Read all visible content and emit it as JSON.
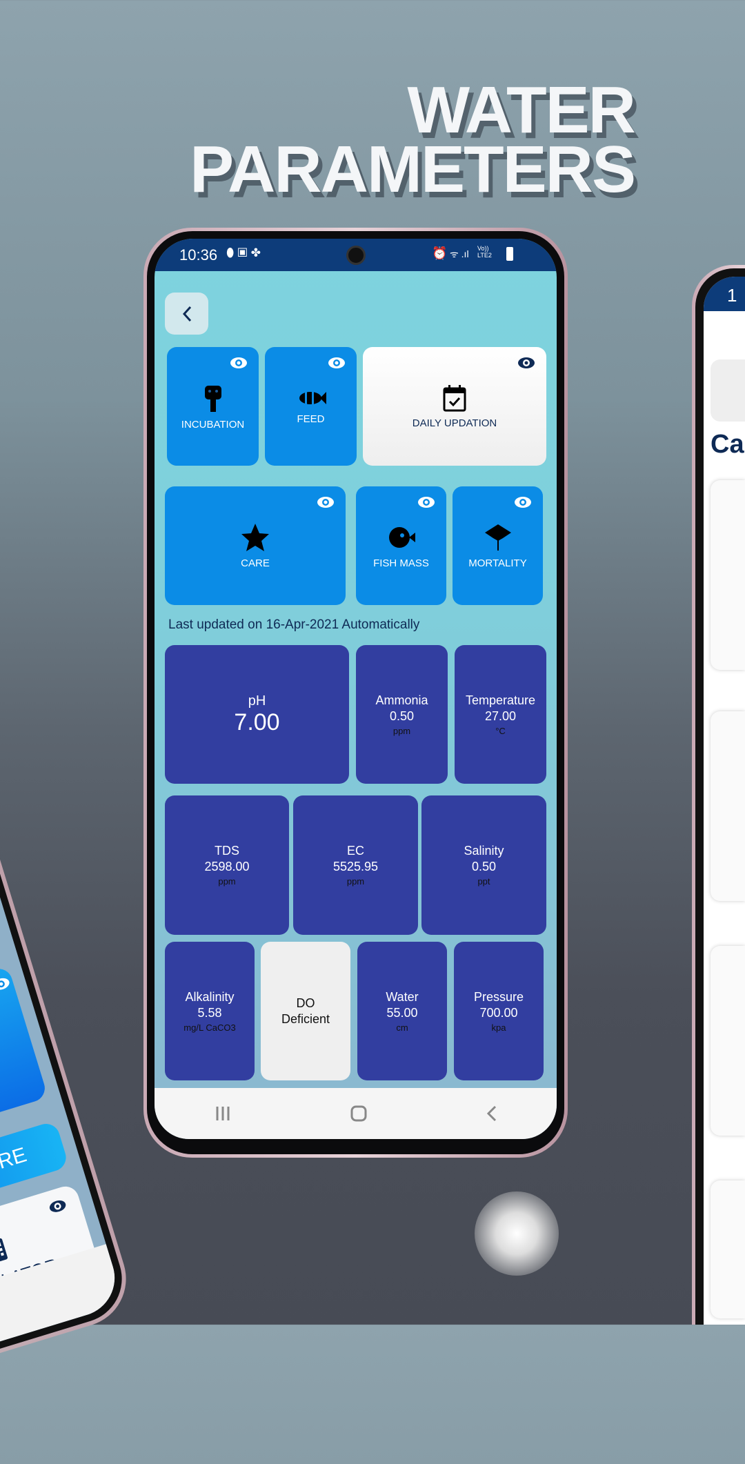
{
  "headline": {
    "line1": "WATER",
    "line2": "PARAMETERS"
  },
  "status_bar": {
    "time": "10:36",
    "network": "Vo)) LTE2"
  },
  "menu_tiles": [
    {
      "label": "INCUBATION",
      "icon": "incubator-icon"
    },
    {
      "label": "FEED",
      "icon": "clownfish-icon"
    },
    {
      "label": "DAILY UPDATION",
      "icon": "calendar-check-icon"
    },
    {
      "label": "CARE",
      "icon": "starfish-icon"
    },
    {
      "label": "FISH MASS",
      "icon": "pufferfish-icon"
    },
    {
      "label": "MORTALITY",
      "icon": "stingray-icon"
    }
  ],
  "last_updated": "Last updated on 16-Apr-2021 Automatically",
  "parameters": [
    {
      "label": "pH",
      "value": "7.00",
      "unit": ""
    },
    {
      "label": "Ammonia",
      "value": "0.50",
      "unit": "ppm"
    },
    {
      "label": "Temperature",
      "value": "27.00",
      "unit": "°C"
    },
    {
      "label": "TDS",
      "value": "2598.00",
      "unit": "ppm"
    },
    {
      "label": "EC",
      "value": "5525.95",
      "unit": "ppm"
    },
    {
      "label": "Salinity",
      "value": "0.50",
      "unit": "ppt"
    },
    {
      "label": "Alkalinity",
      "value": "5.58",
      "unit": "mg/L CaCO3"
    },
    {
      "label": "DO",
      "value": "Deficient",
      "unit": ""
    },
    {
      "label": "Water",
      "value": "55.00",
      "unit": "cm"
    },
    {
      "label": "Pressure",
      "value": "700.00",
      "unit": "kpa"
    }
  ],
  "left_phone": {
    "more_label": "ORE",
    "calculator_label": "CALCULATOR"
  },
  "right_phone": {
    "time_fragment": "1",
    "heading_fragment": "Ca"
  },
  "colors": {
    "tile_blue": "#0b8ce6",
    "param_navy": "#323ea0",
    "status_bar": "#0d3c7a"
  }
}
